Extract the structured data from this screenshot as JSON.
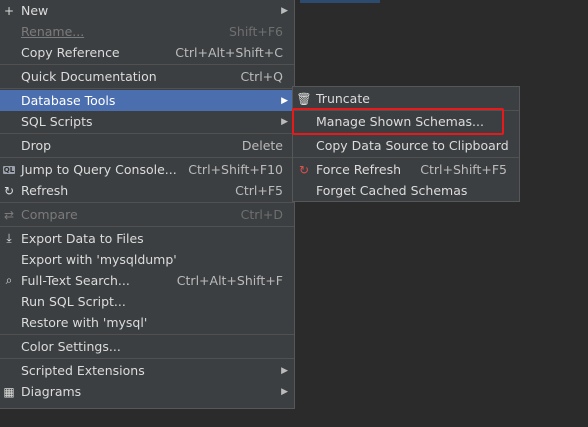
{
  "main_menu": {
    "new": "New",
    "rename": "Rename...",
    "rename_shortcut": "Shift+F6",
    "copy_reference": "Copy Reference",
    "copy_reference_shortcut": "Ctrl+Alt+Shift+C",
    "quick_doc": "Quick Documentation",
    "quick_doc_shortcut": "Ctrl+Q",
    "database_tools": "Database Tools",
    "sql_scripts": "SQL Scripts",
    "drop": "Drop",
    "drop_shortcut": "Delete",
    "jump_console": "Jump to Query Console...",
    "jump_console_shortcut": "Ctrl+Shift+F10",
    "refresh": "Refresh",
    "refresh_shortcut": "Ctrl+F5",
    "compare": "Compare",
    "compare_shortcut": "Ctrl+D",
    "export_files": "Export Data to Files",
    "export_mysqldump": "Export with 'mysqldump'",
    "fulltext_search": "Full-Text Search...",
    "fulltext_search_shortcut": "Ctrl+Alt+Shift+F",
    "run_sql": "Run SQL Script...",
    "restore_mysql": "Restore with 'mysql'",
    "color_settings": "Color Settings...",
    "scripted_extensions": "Scripted Extensions",
    "diagrams": "Diagrams"
  },
  "sub_menu": {
    "truncate": "Truncate",
    "manage_schemas": "Manage Shown Schemas...",
    "copy_datasource": "Copy Data Source to Clipboard",
    "force_refresh": "Force Refresh",
    "force_refresh_shortcut": "Ctrl+Shift+F5",
    "forget_schemas": "Forget Cached Schemas"
  },
  "icons": {
    "query_console": "QL"
  },
  "colors": {
    "menu_bg": "#3c3f41",
    "selected_bg": "#4b6eaf",
    "highlight_border": "#e8191a"
  }
}
